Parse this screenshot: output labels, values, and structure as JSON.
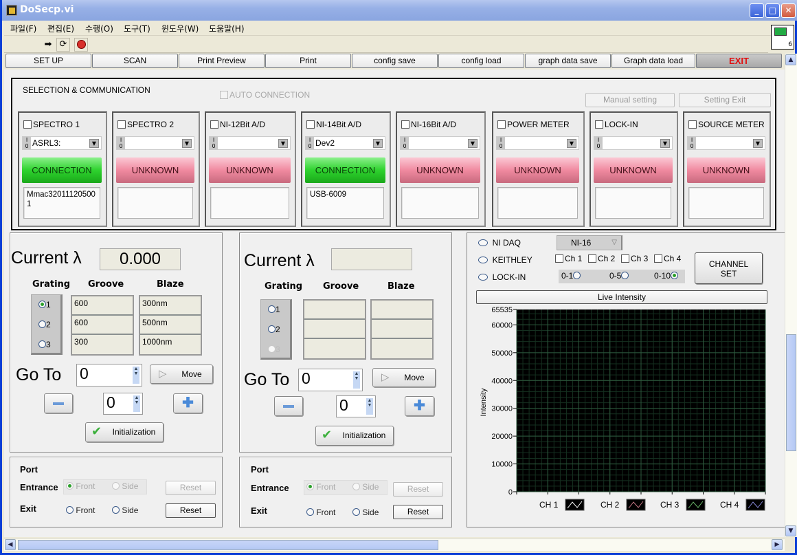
{
  "window": {
    "title": "DoSecp.vi",
    "vi_icon_number": "6"
  },
  "menu": [
    "파일(F)",
    "편집(E)",
    "수행(O)",
    "도구(T)",
    "윈도우(W)",
    "도움말(H)"
  ],
  "toolbar_icons": [
    "run-arrow-icon",
    "run-continuous-icon",
    "abort-stop-icon"
  ],
  "nav": {
    "buttons": [
      "SET UP",
      "SCAN",
      "Print Preview",
      "Print",
      "config save",
      "config load",
      "graph data save",
      "Graph data load"
    ],
    "exit": "EXIT",
    "exit_color": "#e01010"
  },
  "selection": {
    "title": "SELECTION & COMMUNICATION",
    "auto_connection": "AUTO CONNECTION",
    "manual_setting": "Manual setting",
    "setting_exit": "Setting Exit",
    "devices": [
      {
        "label": "SPECTRO 1",
        "resource": "ASRL3:",
        "status": "CONNECTION",
        "info": "Mmac320111205001"
      },
      {
        "label": "SPECTRO 2",
        "resource": "",
        "status": "UNKNOWN",
        "info": ""
      },
      {
        "label": "NI-12Bit A/D",
        "resource": "",
        "status": "UNKNOWN",
        "info": ""
      },
      {
        "label": "NI-14Bit A/D",
        "resource": "Dev2",
        "status": "CONNECTION",
        "info": "USB-6009"
      },
      {
        "label": "NI-16Bit A/D",
        "resource": "",
        "status": "UNKNOWN",
        "info": ""
      },
      {
        "label": "POWER METER",
        "resource": "",
        "status": "UNKNOWN",
        "info": ""
      },
      {
        "label": "LOCK-IN",
        "resource": "",
        "status": "UNKNOWN",
        "info": ""
      },
      {
        "label": "SOURCE METER",
        "resource": "",
        "status": "UNKNOWN",
        "info": ""
      }
    ],
    "status_colors": {
      "CONNECTION": "#2ed22e",
      "UNKNOWN": "#f08aa0"
    }
  },
  "mono1": {
    "current_label": "Current λ",
    "current_value": "0.000",
    "headers": {
      "grating": "Grating",
      "groove": "Groove",
      "blaze": "Blaze"
    },
    "gratings": [
      "1",
      "2",
      "3"
    ],
    "selected_grating": "1",
    "groove": [
      "600",
      "600",
      "300"
    ],
    "blaze": [
      "300nm",
      "500nm",
      "1000nm"
    ],
    "goto_label": "Go To",
    "goto_value": "0",
    "move": "Move",
    "step_value": "0",
    "init": "Initialization"
  },
  "mono2": {
    "current_label": "Current λ",
    "current_value": "",
    "headers": {
      "grating": "Grating",
      "groove": "Groove",
      "blaze": "Blaze"
    },
    "gratings": [
      "1",
      "2",
      "3"
    ],
    "groove": [
      "",
      "",
      ""
    ],
    "blaze": [
      "",
      "",
      ""
    ],
    "goto_label": "Go To",
    "goto_value": "0",
    "move": "Move",
    "step_value": "0",
    "init": "Initialization"
  },
  "port1": {
    "title": "Port",
    "entrance": "Entrance",
    "exit": "Exit",
    "front": "Front",
    "side": "Side",
    "reset": "Reset"
  },
  "port2": {
    "title": "Port",
    "entrance": "Entrance",
    "exit": "Exit",
    "front": "Front",
    "side": "Side",
    "reset": "Reset"
  },
  "detector": {
    "sources": [
      "NI DAQ",
      "KEITHLEY",
      "LOCK-IN"
    ],
    "ni_select": "NI-16",
    "channels": [
      "Ch 1",
      "Ch 2",
      "Ch 3",
      "Ch 4"
    ],
    "ranges": [
      "0-1",
      "0-5",
      "0-10"
    ],
    "selected_range": "0-10",
    "channel_set": [
      "CHANNEL",
      "SET"
    ],
    "live_intensity": "Live Intensity"
  },
  "chart_data": {
    "type": "line",
    "title": "Live Intensity",
    "xlabel": "",
    "ylabel": "Intensity",
    "ylim": [
      0,
      65535
    ],
    "yticks": [
      0,
      10000,
      20000,
      30000,
      40000,
      50000,
      60000,
      65535
    ],
    "ytick_labels": [
      "0",
      "10000",
      "20000",
      "30000",
      "40000",
      "50000",
      "60000",
      "65535"
    ],
    "grid": true,
    "background": "#000000",
    "grid_color": "#2e5a3e",
    "legend_position": "bottom",
    "series": [
      {
        "name": "CH 1",
        "color": "#ffffff",
        "values": []
      },
      {
        "name": "CH 2",
        "color": "#c87888",
        "values": []
      },
      {
        "name": "CH 3",
        "color": "#6ab86a",
        "values": []
      },
      {
        "name": "CH 4",
        "color": "#8888d8",
        "values": []
      }
    ]
  }
}
